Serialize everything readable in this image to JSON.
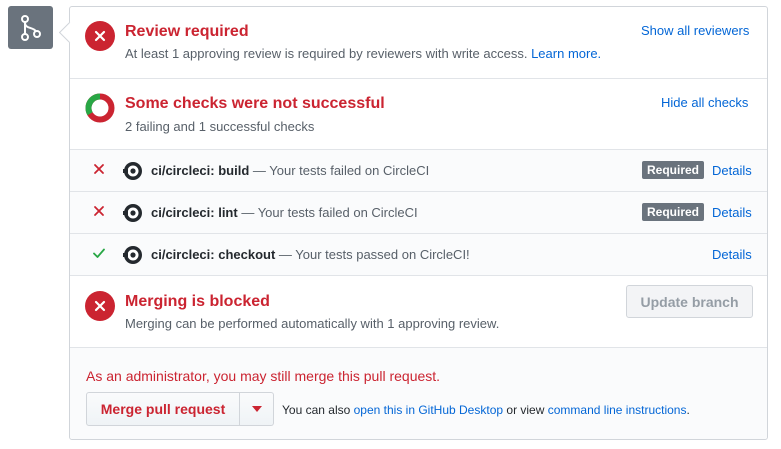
{
  "review": {
    "title": "Review required",
    "subtitle": "At least 1 approving review is required by reviewers with write access.",
    "learn_more": "Learn more.",
    "show_reviewers": "Show all reviewers"
  },
  "checks_summary": {
    "title": "Some checks were not successful",
    "subtitle": "2 failing and 1 successful checks",
    "hide_checks": "Hide all checks",
    "donut": {
      "failing": 2,
      "successful": 1,
      "fail_color": "#cb2431",
      "success_color": "#28a745"
    }
  },
  "checks": [
    {
      "status": "failed",
      "name": "ci/circleci: build",
      "description": "— Your tests failed on CircleCI",
      "required": "Required",
      "details": "Details"
    },
    {
      "status": "failed",
      "name": "ci/circleci: lint",
      "description": "— Your tests failed on CircleCI",
      "required": "Required",
      "details": "Details"
    },
    {
      "status": "passed",
      "name": "ci/circleci: checkout",
      "description": "— Your tests passed on CircleCI!",
      "required": "",
      "details": "Details"
    }
  ],
  "merge_blocked": {
    "title": "Merging is blocked",
    "subtitle": "Merging can be performed automatically with 1 approving review.",
    "update_branch": "Update branch"
  },
  "footer": {
    "admin_note": "As an administrator, you may still merge this pull request.",
    "merge_button": "Merge pull request",
    "also_prefix": "You can also",
    "desktop_link": "open this in GitHub Desktop",
    "or_view": "or view",
    "cli_link": "command line instructions",
    "period": "."
  },
  "colors": {
    "danger": "#cb2431",
    "success": "#28a745",
    "link": "#0366d6",
    "muted": "#586069"
  },
  "icons": {
    "merge": "git-merge-icon",
    "fail": "x-icon",
    "pass": "check-icon",
    "ci": "circleci-icon",
    "caret": "caret-down-icon"
  }
}
